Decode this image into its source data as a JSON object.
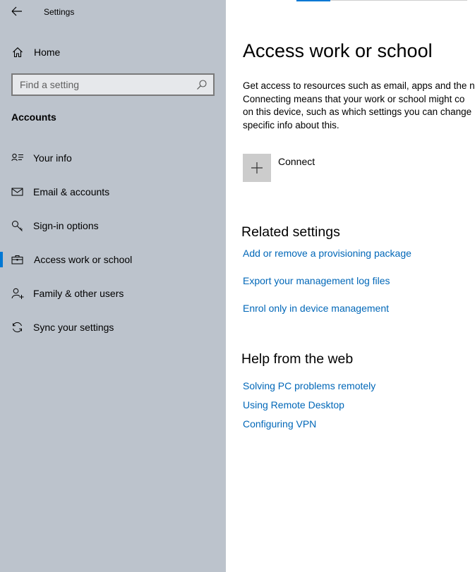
{
  "window": {
    "title": "Settings"
  },
  "sidebar": {
    "home_label": "Home",
    "search": {
      "placeholder": "Find a setting",
      "value": ""
    },
    "section_title": "Accounts",
    "items": [
      {
        "label": "Your info",
        "icon": "person-card-icon"
      },
      {
        "label": "Email & accounts",
        "icon": "mail-icon"
      },
      {
        "label": "Sign-in options",
        "icon": "key-icon"
      },
      {
        "label": "Access work or school",
        "icon": "briefcase-icon",
        "selected": true
      },
      {
        "label": "Family & other users",
        "icon": "person-add-icon"
      },
      {
        "label": "Sync your settings",
        "icon": "sync-icon"
      }
    ]
  },
  "main": {
    "title": "Access work or school",
    "description": [
      "Get access to resources such as email, apps and the n",
      "Connecting means that your work or school might co",
      "on this device, such as which settings you can change",
      "specific info about this."
    ],
    "connect_label": "Connect",
    "related": {
      "title": "Related settings",
      "links": [
        "Add or remove a provisioning package",
        "Export your management log files",
        "Enrol only in device management"
      ]
    },
    "help": {
      "title": "Help from the web",
      "links": [
        "Solving PC problems remotely",
        "Using Remote Desktop",
        "Configuring VPN"
      ]
    }
  },
  "colors": {
    "accent": "#0078d4",
    "link": "#0067b8",
    "sidebar_bg": "#bcc3cc"
  }
}
